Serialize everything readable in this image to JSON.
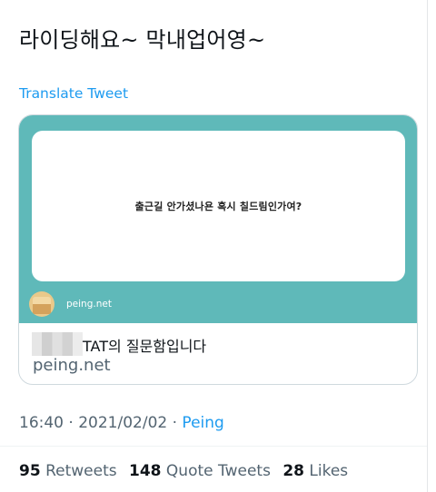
{
  "tweet": {
    "text": "라이딩해요~ 막내업어영~",
    "translate_label": "Translate Tweet"
  },
  "card": {
    "question": "출근길 안가셨나욘 혹시 칠드림인가여?",
    "image_site_label": "peing.net",
    "title": "TAT의 질문함입니다",
    "domain": "peing.net"
  },
  "meta": {
    "time": "16:40",
    "separator1": " · ",
    "date": "2021/02/02",
    "separator2": " · ",
    "source": "Peing"
  },
  "stats": {
    "retweets": {
      "count": "95",
      "label": "Retweets"
    },
    "quotes": {
      "count": "148",
      "label": "Quote Tweets"
    },
    "likes": {
      "count": "28",
      "label": "Likes"
    }
  },
  "colors": {
    "accent": "#1d9bf0",
    "card_teal": "#5fb9b9",
    "muted_text": "#536471"
  }
}
